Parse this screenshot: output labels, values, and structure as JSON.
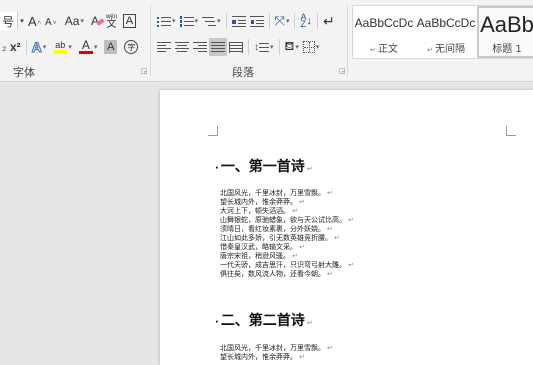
{
  "ribbon": {
    "font_group": {
      "label": "字体",
      "font_size_label": "号",
      "grow_icon": "A",
      "shrink_icon": "A",
      "change_case_label": "Aa",
      "clear_format_icon": "A",
      "phonetic_icon": "wén",
      "border_char_icon": "A",
      "superscript_label": "x²",
      "text_effect_icon": "A",
      "highlight_icon": "ab",
      "font_color_icon": "A",
      "char_shading_icon": "A",
      "enclose_char_icon": "字",
      "highlight_color": "#ffff00",
      "font_color": "#e00000"
    },
    "paragraph_group": {
      "label": "段落"
    },
    "styles_group": {
      "items": [
        {
          "sample": "AaBbCcDc",
          "name": "正文"
        },
        {
          "sample": "AaBbCcDc",
          "name": "无间隔"
        },
        {
          "sample": "AaBb",
          "name": "标题 1"
        }
      ]
    }
  },
  "document": {
    "sections": [
      {
        "heading": "一、第一首诗",
        "lines": [
          "北国风光，千里冰封，万里雪飘。",
          "望长城内外，惟余莽莽。",
          "大河上下，顿失滔滔。",
          "山舞银蛇，原驰蜡象，欲与天公试比高。",
          "须晴日，看红妆素裹，分外妖娆。",
          "江山如此多娇，引无数英雄竞折腰。",
          "惜秦皇汉武，略输文采。",
          "唐宗宋祖，稍逊风骚。",
          "一代天骄，成吉思汗，只识弯弓射大雕。",
          "俱往矣，数风流人物，还看今朝。"
        ]
      },
      {
        "heading": "二、第二首诗",
        "lines": [
          "北国风光，千里冰封，万里雪飘。",
          "望长城内外，惟余莽莽。"
        ]
      }
    ]
  }
}
